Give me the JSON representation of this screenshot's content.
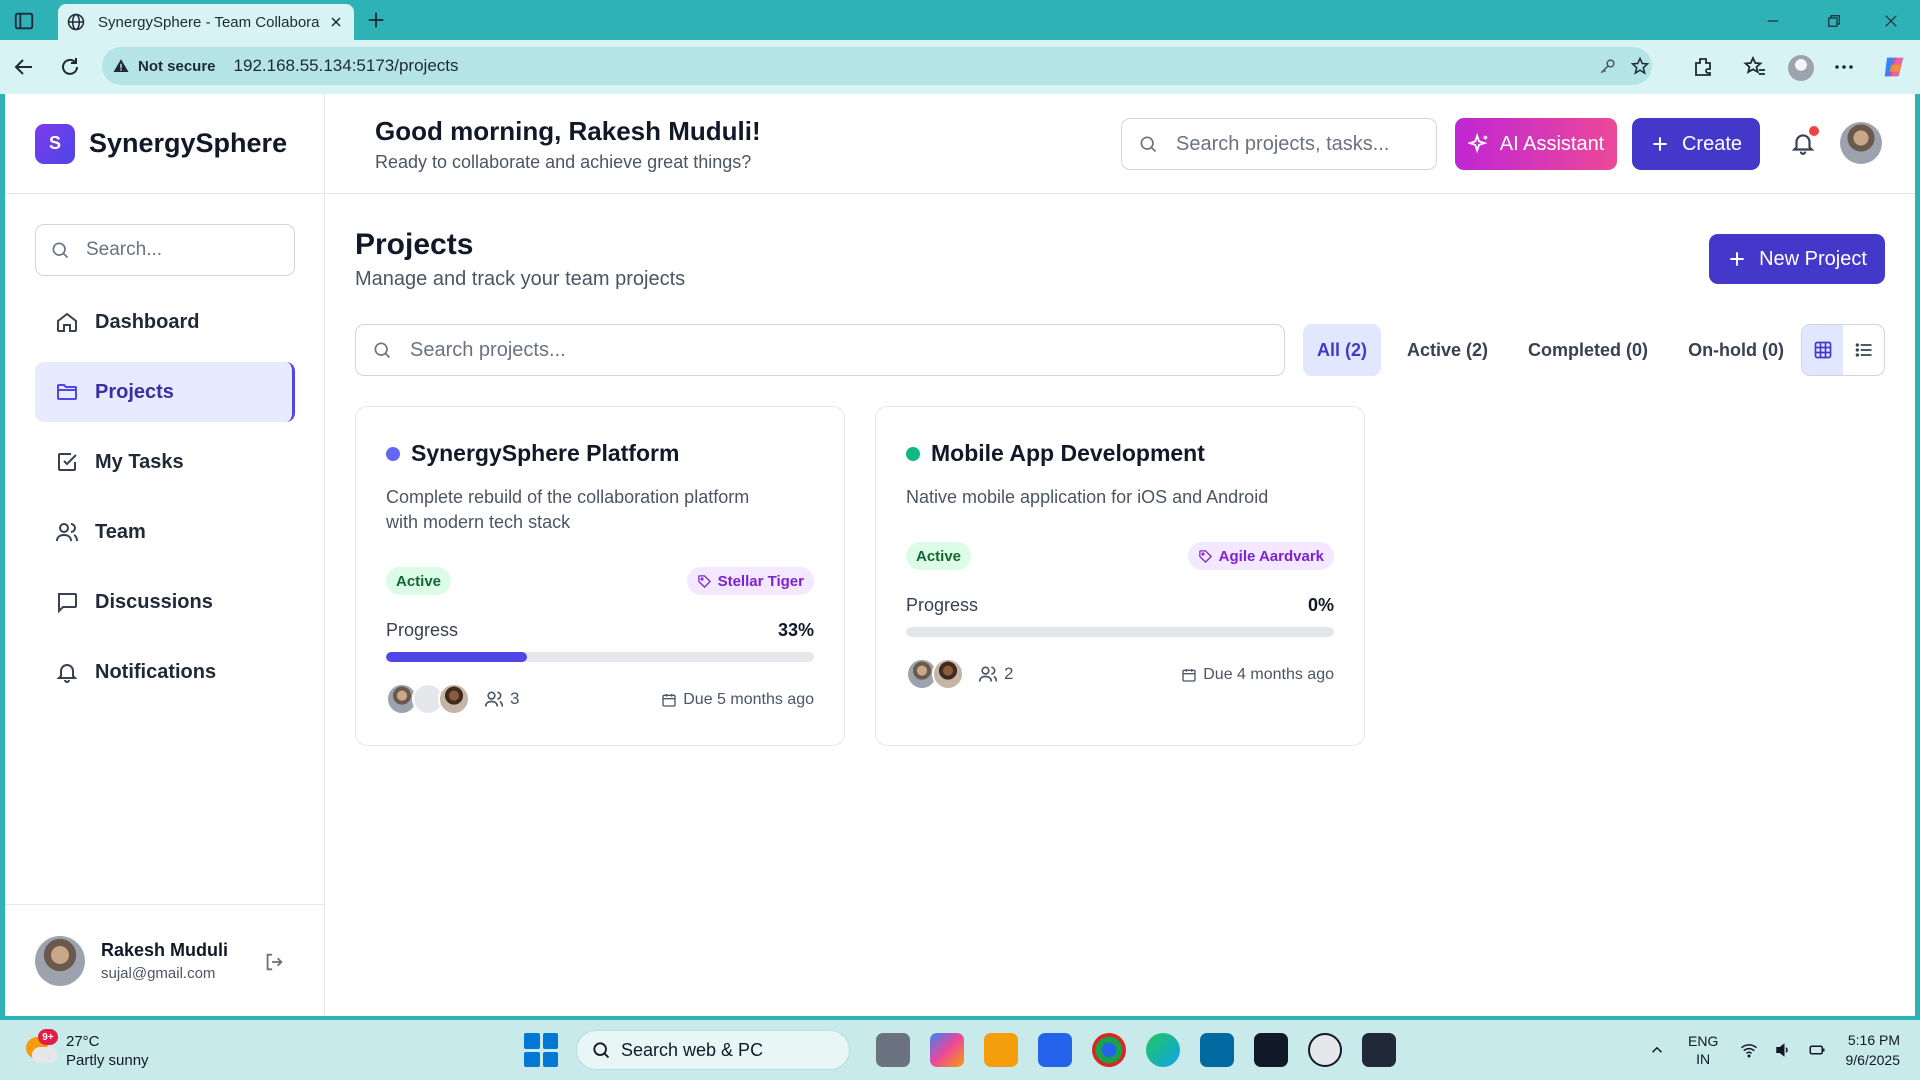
{
  "browser": {
    "tab_title": "SynergySphere - Team Collaborat",
    "security_label": "Not secure",
    "url": "192.168.55.134:5173/projects"
  },
  "app": {
    "brand_letter": "S",
    "brand_name": "SynergySphere",
    "sidebar_search_placeholder": "Search...",
    "nav": [
      {
        "label": "Dashboard",
        "icon": "home-icon"
      },
      {
        "label": "Projects",
        "icon": "folder-icon",
        "active": true
      },
      {
        "label": "My Tasks",
        "icon": "check-square-icon"
      },
      {
        "label": "Team",
        "icon": "users-icon"
      },
      {
        "label": "Discussions",
        "icon": "message-square-icon"
      },
      {
        "label": "Notifications",
        "icon": "bell-icon"
      }
    ],
    "user": {
      "name": "Rakesh Muduli",
      "email": "sujal@gmail.com"
    }
  },
  "header": {
    "greeting": "Good morning, Rakesh Muduli!",
    "subtitle": "Ready to collaborate and achieve great things?",
    "search_placeholder": "Search projects, tasks...",
    "ai_label": "AI Assistant",
    "create_label": "Create"
  },
  "page": {
    "title": "Projects",
    "subtitle": "Manage and track your team projects",
    "new_project_label": "New Project",
    "search_placeholder": "Search projects...",
    "filters": [
      "All (2)",
      "Active (2)",
      "Completed (0)",
      "On-hold (0)"
    ],
    "active_filter": "All (2)",
    "view_mode": "grid"
  },
  "projects": [
    {
      "title": "SynergySphere Platform",
      "dot_color": "#6366f1",
      "description": "Complete rebuild of the collaboration platform with modern tech stack",
      "status": "Active",
      "tag": "Stellar Tiger",
      "progress_label": "Progress",
      "progress_text": "33%",
      "progress": 0.33,
      "member_count": "3",
      "due": "Due 5 months ago"
    },
    {
      "title": "Mobile App Development",
      "dot_color": "#10b981",
      "description": "Native mobile application for iOS and Android",
      "status": "Active",
      "tag": "Agile Aardvark",
      "progress_label": "Progress",
      "progress_text": "0%",
      "progress": 0,
      "member_count": "2",
      "due": "Due 4 months ago"
    }
  ],
  "taskbar": {
    "weather_badge": "9+",
    "temperature": "27°C",
    "condition": "Partly sunny",
    "search_label": "Search web & PC",
    "lang_top": "ENG",
    "lang_bottom": "IN",
    "time": "5:16 PM",
    "date": "9/6/2025"
  },
  "colors": {
    "accent": "#4338ca",
    "ai_gradient_start": "#c026d3",
    "ai_gradient_end": "#ec4899",
    "status_green": "#166534"
  }
}
